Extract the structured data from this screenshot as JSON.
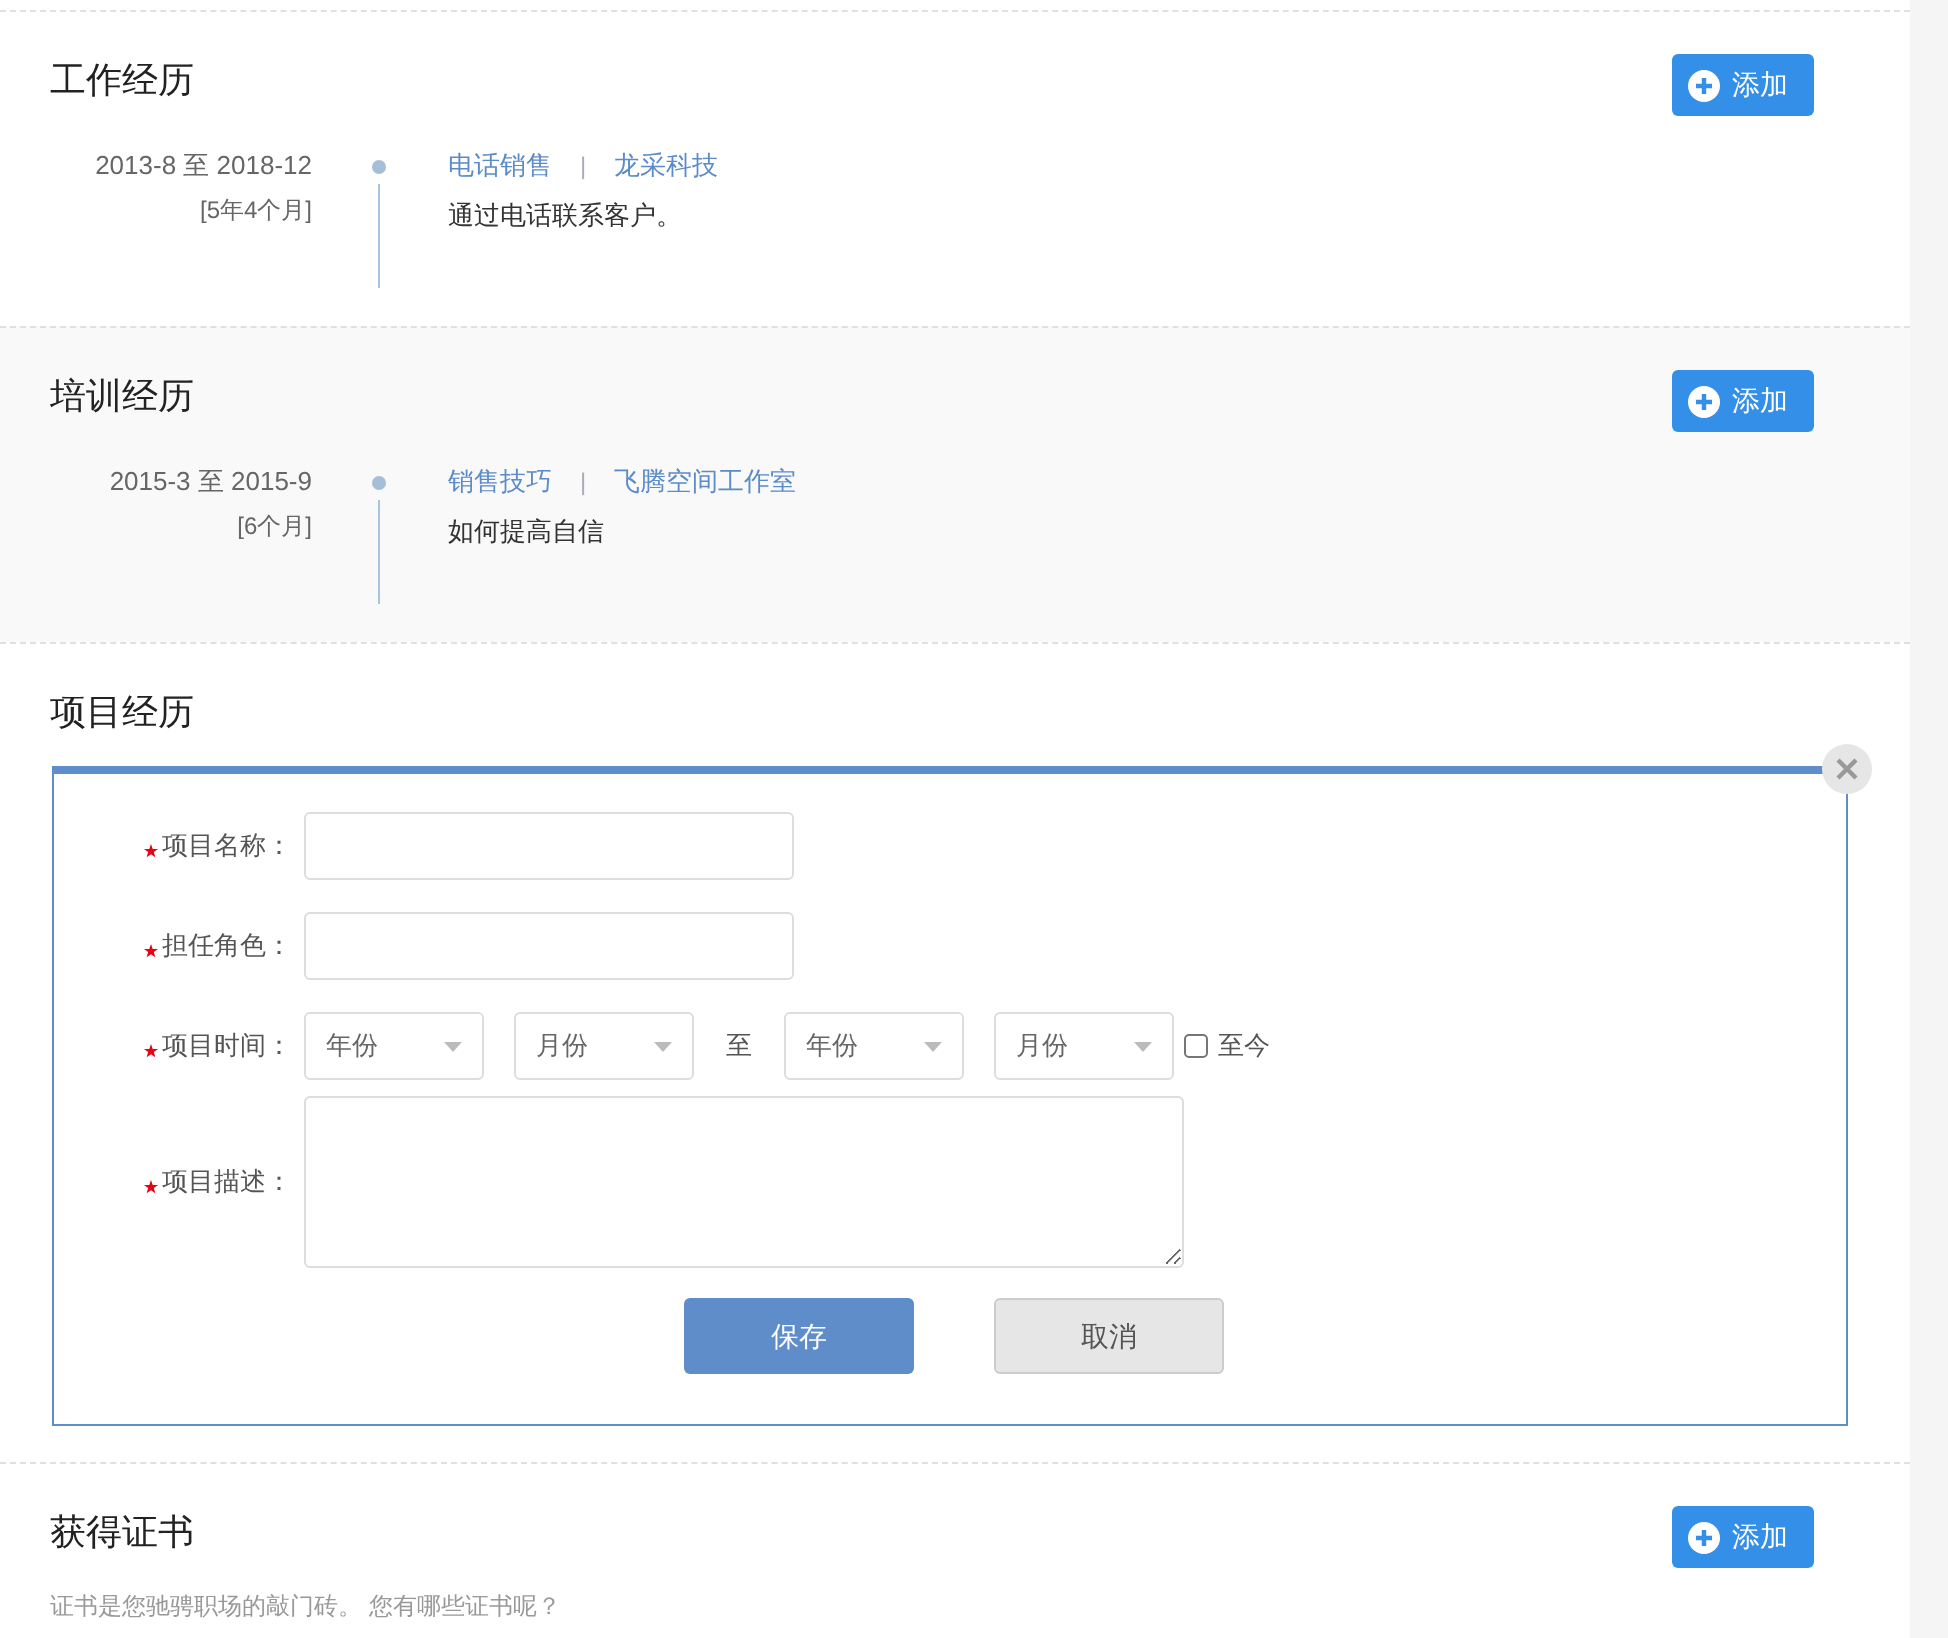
{
  "sections": [
    {
      "kind": "timeline",
      "title": "工作经历",
      "add_button": "添加",
      "entries": [
        {
          "dates": "2013-8 至 2018-12",
          "duration": "[5年4个月]",
          "role": "电话销售",
          "separator": "|",
          "organization": "龙采科技",
          "description": "通过电话联系客户。"
        }
      ]
    },
    {
      "kind": "timeline",
      "title": "培训经历",
      "add_button": "添加",
      "entries": [
        {
          "dates": "2015-3 至 2015-9",
          "duration": "[6个月]",
          "role": "销售技巧",
          "separator": "|",
          "organization": "飞腾空间工作室",
          "description": "如何提高自信"
        }
      ]
    },
    {
      "kind": "form",
      "title": "项目经历",
      "fields": [
        {
          "kind": "text",
          "label": "项目名称：",
          "required": true
        },
        {
          "kind": "text",
          "label": "担任角色：",
          "required": true
        },
        {
          "kind": "date_range",
          "label": "项目时间：",
          "required": true,
          "start": [
            "年份",
            "月份"
          ],
          "to": "至",
          "end": [
            "年份",
            "月份"
          ],
          "until_now": {
            "label": "至今",
            "checked": false
          }
        },
        {
          "kind": "textarea",
          "label": "项目描述：",
          "required": true
        }
      ],
      "save_button": "保存",
      "cancel_button": "取消"
    },
    {
      "kind": "empty",
      "title": "获得证书",
      "add_button": "添加",
      "hint": "证书是您驰骋职场的敲门砖。 您有哪些证书呢？"
    }
  ]
}
